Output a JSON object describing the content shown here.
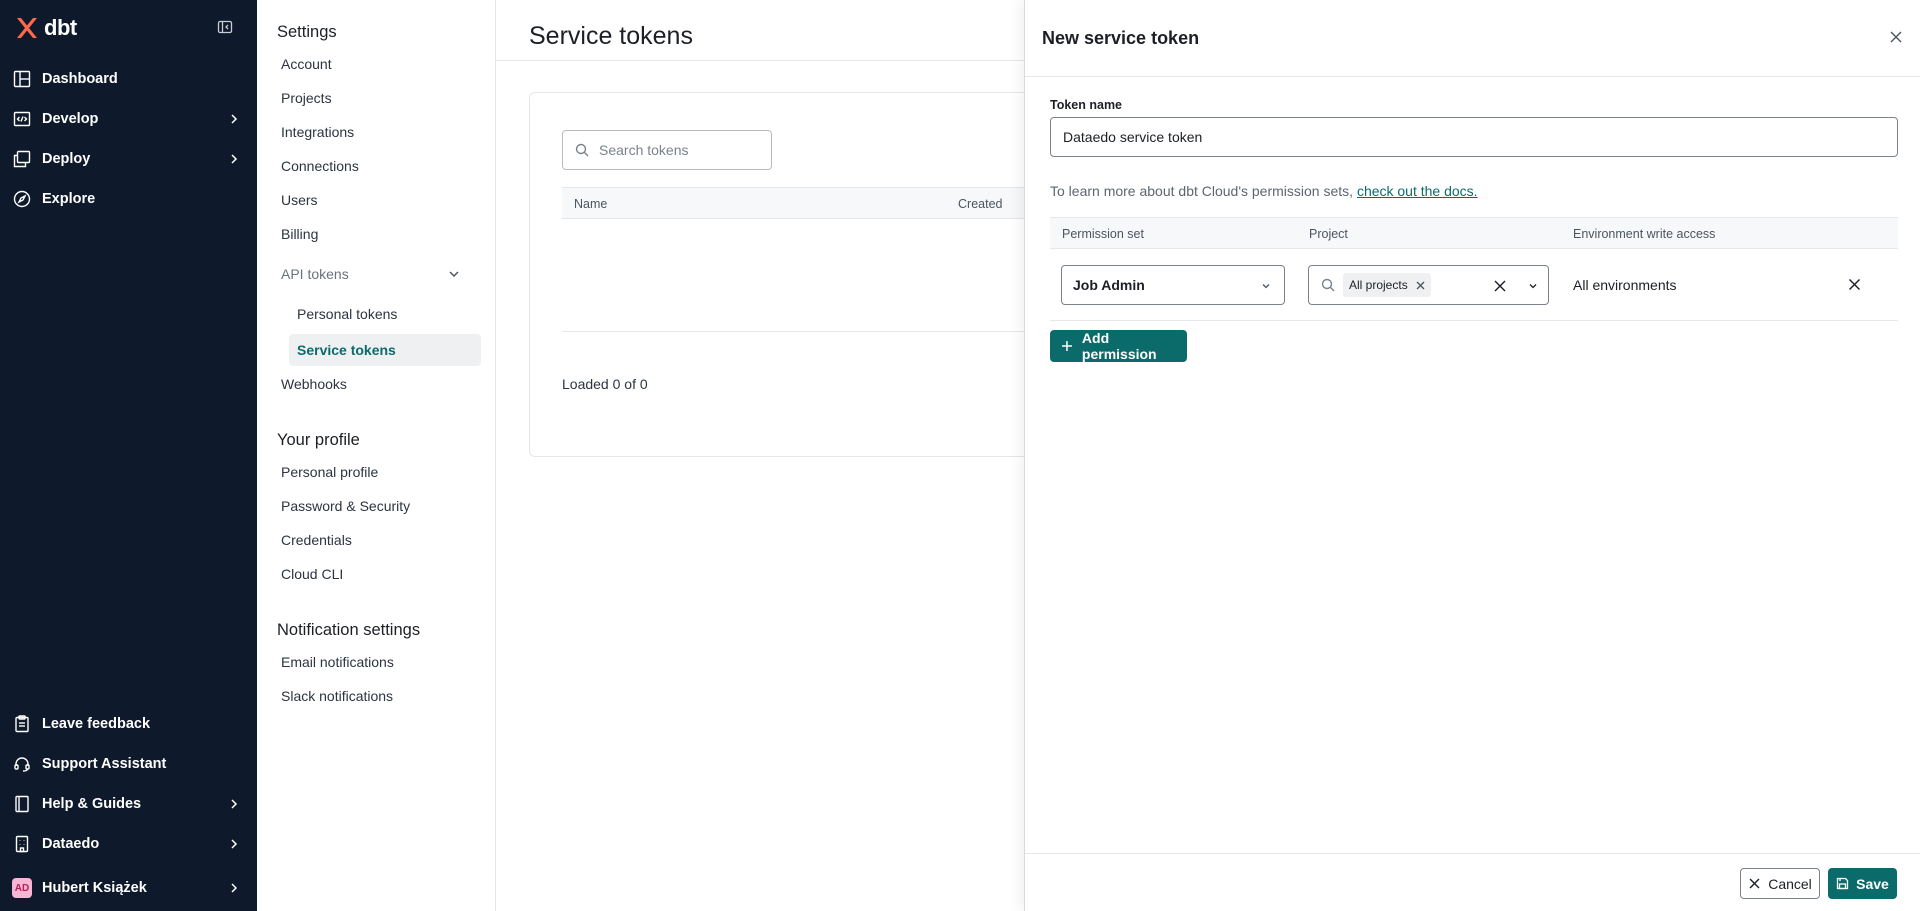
{
  "brand": {
    "name": "dbt",
    "accent": "#ff694a"
  },
  "nav": {
    "items": [
      {
        "label": "Dashboard",
        "icon": "dashboard-icon"
      },
      {
        "label": "Develop",
        "icon": "develop-icon"
      },
      {
        "label": "Deploy",
        "icon": "deploy-icon"
      },
      {
        "label": "Explore",
        "icon": "explore-icon"
      }
    ],
    "bottom": [
      {
        "label": "Leave feedback",
        "icon": "feedback-icon"
      },
      {
        "label": "Support Assistant",
        "icon": "headset-icon"
      },
      {
        "label": "Help & Guides",
        "icon": "book-icon"
      },
      {
        "label": "Dataedo",
        "icon": "building-icon"
      },
      {
        "label": "Hubert Książek",
        "avatar": "AD"
      }
    ]
  },
  "settings": {
    "title": "Settings",
    "links": [
      "Account",
      "Projects",
      "Integrations",
      "Connections",
      "Users",
      "Billing"
    ],
    "api_tokens": "API tokens",
    "api_sub": [
      "Personal tokens",
      "Service tokens"
    ],
    "webhooks": "Webhooks",
    "profile_title": "Your profile",
    "profile_links": [
      "Personal profile",
      "Password & Security",
      "Credentials",
      "Cloud CLI"
    ],
    "notif_title": "Notification settings",
    "notif_links": [
      "Email notifications",
      "Slack notifications"
    ]
  },
  "main": {
    "title": "Service tokens",
    "search_placeholder": "Search tokens",
    "columns": [
      "Name",
      "Created"
    ],
    "loaded": "Loaded 0 of 0"
  },
  "drawer": {
    "title": "New service token",
    "token_name_label": "Token name",
    "token_name_value": "Dataedo service token",
    "help_text": "To learn more about dbt Cloud's permission sets,",
    "help_link": "check out the docs.",
    "columns": [
      "Permission set",
      "Project",
      "Environment write access"
    ],
    "row": {
      "permission_set": "Job Admin",
      "project_chip": "All projects",
      "environment": "All environments"
    },
    "add_permission": "Add permission",
    "cancel": "Cancel",
    "save": "Save"
  },
  "colors": {
    "primary": "#0b6b6a",
    "sidebar": "#0e1a2b"
  }
}
